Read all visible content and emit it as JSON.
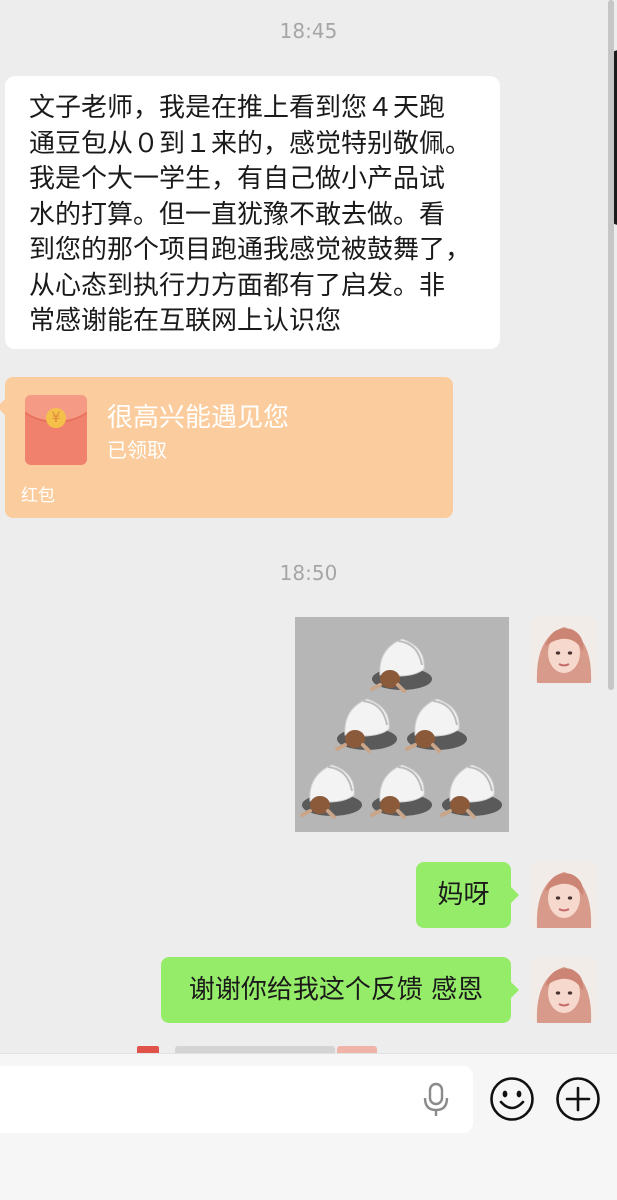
{
  "timestamps": [
    "18:45",
    "18:50"
  ],
  "messages": {
    "incoming_text": "文子老师，我是在推上看到您４天跑\n通豆包从０到１来的，感觉特别敬佩。\n我是个大一学生，有自己做小产品试\n水的打算。但一直犹豫不敢去做。看\n到您的那个项目跑通我感觉被鼓舞了，\n从心态到执行力方面都有了启发。非\n常感谢能在互联网上认识您",
    "red_packet": {
      "title": "很高兴能遇见您",
      "status": "已领取",
      "label": "红包"
    },
    "outgoing_1": "妈呀",
    "outgoing_2": "谢谢你给我这个反馈 感恩"
  },
  "input": {
    "value": ""
  },
  "colors": {
    "background": "#ededed",
    "outgoing_bubble": "#95ec69",
    "red_packet": "#fbcd9e",
    "incoming_bubble": "#ffffff"
  },
  "icons": [
    "microphone-icon",
    "emoji-icon",
    "plus-icon"
  ]
}
